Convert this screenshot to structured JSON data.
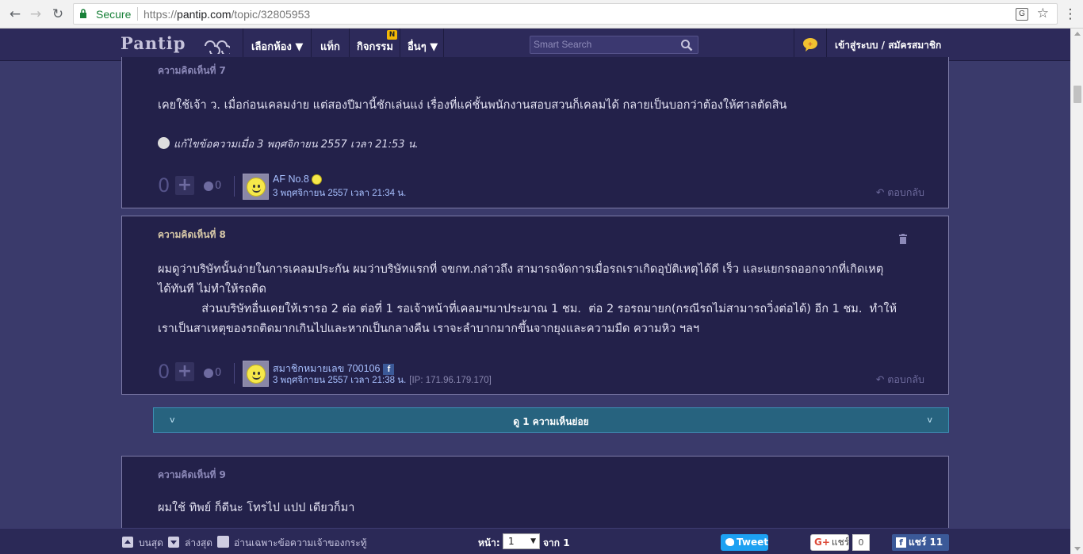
{
  "browser": {
    "secure_label": "Secure",
    "url_scheme": "https://",
    "url_host": "pantip.com",
    "url_path": "/topic/32805953"
  },
  "header": {
    "logo": "Pantip",
    "nav": [
      {
        "label": "เลือกห้อง ▼"
      },
      {
        "label": "แท็ก"
      },
      {
        "label": "กิจกรรม",
        "badge": "N"
      },
      {
        "label": "อื่นๆ ▼"
      }
    ],
    "search_placeholder": "Smart Search",
    "login": "เข้าสู่ระบบ / สมัครสมาชิก"
  },
  "comments": [
    {
      "number": "ความคิดเห็นที่ 7",
      "text": "เคยใช้เจ้า ว. เมื่อก่อนเคลมง่าย  แต่สองปีมานี้ชักเล่นแง่  เรื่องที่แค่ชั้นพนักงานสอบสวนก็เคลมได้  กลายเป็นบอกว่าต้องให้ศาลตัดสิน",
      "edited": "แก้ไขข้อความเมื่อ 3 พฤศจิกายน 2557 เวลา 21:53 น.",
      "votes": "0",
      "emotions": "0",
      "user": "AF No.8",
      "time": "3 พฤศจิกายน 2557 เวลา 21:34 น.",
      "reply": "ตอบกลับ"
    },
    {
      "number": "ความคิดเห็นที่ 8",
      "text_lines": [
        "ผมดูว่าบริษัทนั้นง่ายในการเคลมประกัน ผมว่าบริษัทแรกที่ จขกท.กล่าวถึง สามารถจัดการเมื่อรถเราเกิดอุบัติเหตุได้ดี เร็ว และแยกรถออกจากที่เกิดเหตุ",
        "ได้ทันที  ไม่ทำให้รถติด",
        "            ส่วนบริษัทอื่นเคยให้เรารอ 2 ต่อ ต่อที่ 1 รอเจ้าหน้าที่เคลมฯมาประมาณ 1 ชม.  ต่อ 2 รอรถมายก(กรณีรถไม่สามารถวิ่งต่อได้) อีก 1 ชม.  ทำให้",
        "เราเป็นสาเหตุของรถติดมากเกินไปและหากเป็นกลางคืน เราจะลำบากมากขึ้นจากยุงและความมืด ความหิว ฯลฯ"
      ],
      "votes": "0",
      "emotions": "0",
      "user": "สมาชิกหมายเลข 700106",
      "time": "3 พฤศจิกายน 2557 เวลา 21:38 น.",
      "ip": "[IP: 171.96.179.170]",
      "reply": "ตอบกลับ"
    },
    {
      "number": "ความคิดเห็นที่ 9",
      "text": "ผมใช้ ทิพย์ ก็ดีนะ  โทรไป แปป เดียวก็มา"
    }
  ],
  "expand": {
    "label": "ดู 1 ความเห็นย่อย",
    "chevron": "v"
  },
  "bottom": {
    "top_label": "บนสุด",
    "bottom_label": "ล่างสุด",
    "owner_only": "อ่านเฉพาะข้อความเจ้าของกระทู้",
    "page_label": "หน้า:",
    "page_value": "1",
    "page_total": "จาก 1",
    "tweet": "Tweet",
    "gplus_label": "แชร์",
    "gplus_count": "0",
    "fb_share": "แชร์ 11"
  }
}
